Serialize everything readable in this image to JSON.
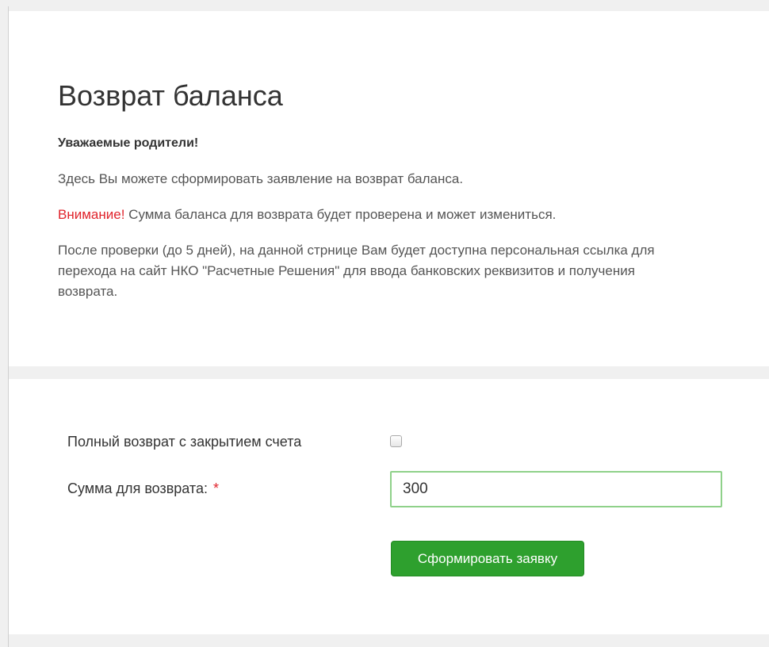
{
  "header": {
    "title": "Возврат баланса"
  },
  "intro": {
    "greeting": "Уважаемые родители!",
    "text1": "Здесь Вы можете сформировать заявление на возврат баланса.",
    "warning_label": "Внимание!",
    "warning_text": " Сумма баланса для возврата будет проверена и может измениться.",
    "text3": "После проверки (до 5 дней), на данной стрнице Вам будет доступна персональная ссылка для перехода на сайт НКО \"Расчетные Решения\" для ввода банковских реквизитов и получения возврата."
  },
  "form": {
    "full_refund_label": "Полный возврат с закрытием счета",
    "full_refund_checked": false,
    "amount_label": "Сумма для возврата: ",
    "required_marker": "*",
    "amount_value": "300",
    "submit_label": "Сформировать заявку"
  },
  "colors": {
    "accent_green": "#2ea02e",
    "warning_red": "#e0242c",
    "input_border_focus": "#8fd18a"
  }
}
